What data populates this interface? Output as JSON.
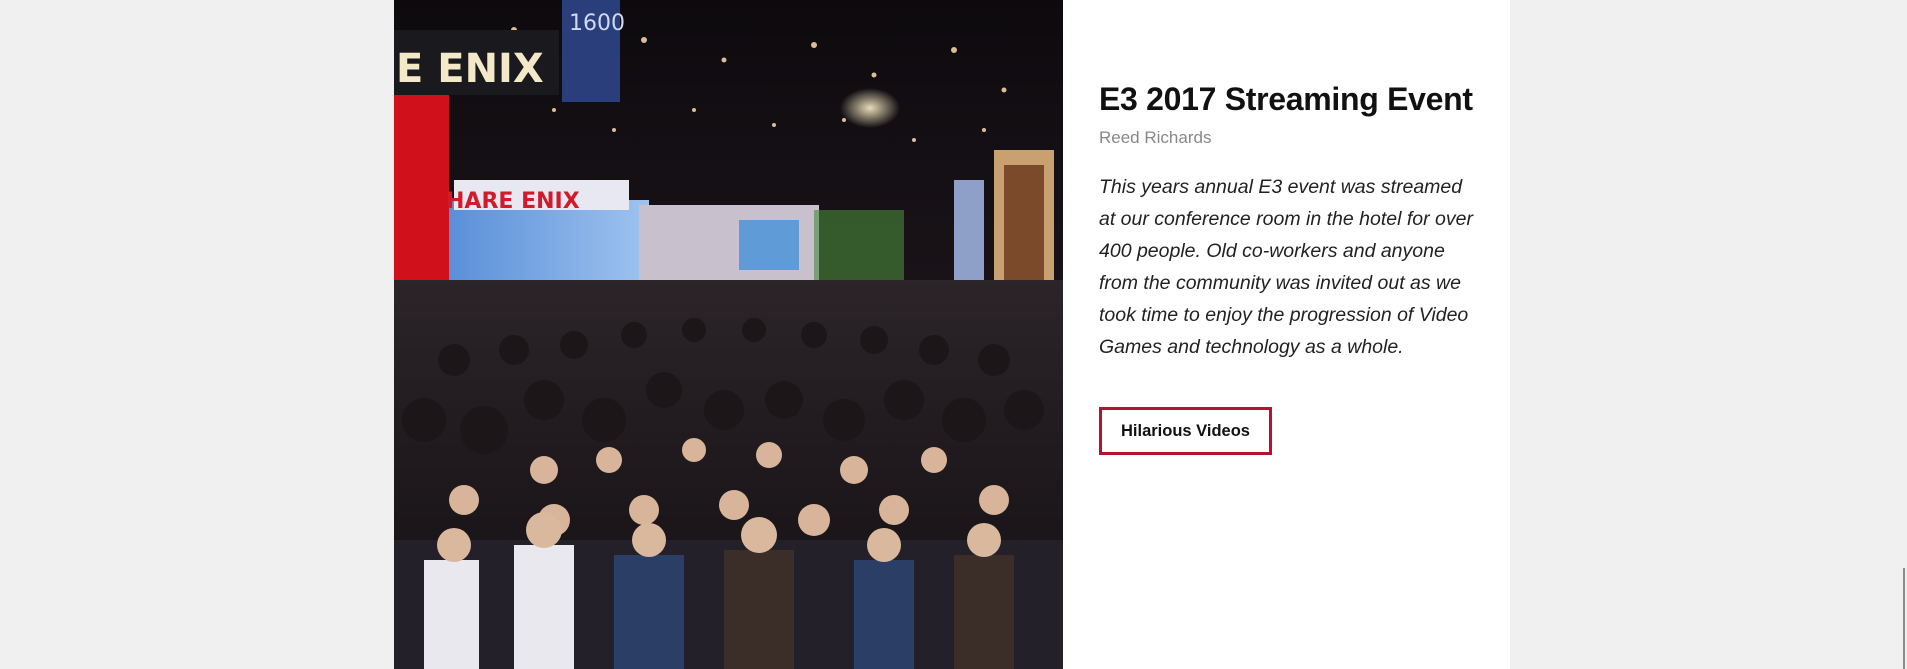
{
  "post": {
    "title": "E3 2017 Streaming Event",
    "author": "Reed Richards",
    "description": "This years annual E3 event was streamed at our conference room in the hotel for over 400 people. Old co-workers and anyone from the community was invited out as we took time to enjoy the progression of Video Games and technology as a whole.",
    "button_label": "Hilarious Videos"
  },
  "photo": {
    "sign_text_1": "E ENIX",
    "sign_text_2": "HARE ENIX",
    "sign_text_3": "1600"
  },
  "colors": {
    "page_bg": "#f0f0f0",
    "card_bg": "#ffffff",
    "button_border": "#b01530"
  }
}
